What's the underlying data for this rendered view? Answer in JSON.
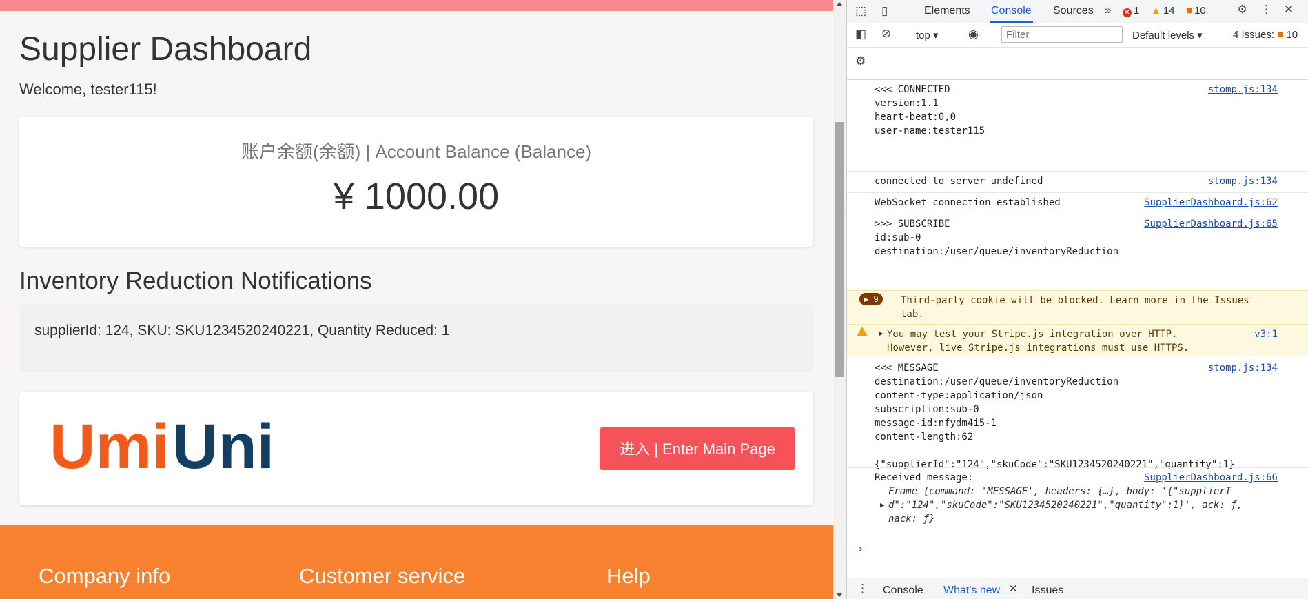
{
  "app": {
    "title": "Supplier Dashboard",
    "welcome": "Welcome, tester115!",
    "balance_label": "账户余额(余额) | Account Balance (Balance)",
    "balance_amount": "¥ 1000.00",
    "notifications_heading": "Inventory Reduction Notifications",
    "notification_text": "supplierId: 124, SKU: SKU1234520240221, Quantity Reduced: 1",
    "logo_text_1": "Umi",
    "logo_text_2": "Uni",
    "enter_button": "进入 | Enter Main Page",
    "footer": {
      "col1": "Company info",
      "col2": "Customer service",
      "col3": "Help"
    },
    "colors": {
      "top_bar": "#f8878e",
      "button": "#f5525a",
      "footer": "#f7812e",
      "logo_orange": "#f05a1a",
      "logo_navy": "#143f63"
    }
  },
  "devtools": {
    "tabs": [
      "Elements",
      "Console",
      "Sources"
    ],
    "active_tab": "Console",
    "more_tabs_icon": "chevron-double-right-icon",
    "errors_count": "1",
    "warnings_count": "14",
    "issues_count": "10",
    "toolbar": {
      "context": "top",
      "filter_placeholder": "Filter",
      "levels": "Default levels",
      "issues_label": "4 Issues:",
      "issues_badge": "10"
    },
    "messages": [
      {
        "text": "<<< CONNECTED\nversion:1.1\nheart-beat:0,0\nuser-name:tester115",
        "source": "stomp.js:134"
      },
      {
        "text": "connected to server undefined",
        "source": "stomp.js:134"
      },
      {
        "text": "WebSocket connection established",
        "source": "SupplierDashboard.js:62"
      },
      {
        "text": ">>> SUBSCRIBE\nid:sub-0\ndestination:/user/queue/inventoryReduction",
        "source": "SupplierDashboard.js:65"
      },
      {
        "count": "9",
        "text": "Third-party cookie will be blocked. Learn more in the Issues\ntab."
      },
      {
        "text": "You may test your Stripe.js integration over HTTP.\nHowever, live Stripe.js integrations must use HTTPS.",
        "source": "v3:1"
      },
      {
        "text": "<<< MESSAGE\ndestination:/user/queue/inventoryReduction\ncontent-type:application/json\nsubscription:sub-0\nmessage-id:nfydm4i5-1\ncontent-length:62\n\n{\"supplierId\":\"124\",\"skuCode\":\"SKU1234520240221\",\"quantity\":1}",
        "source": "stomp.js:134"
      },
      {
        "text": "Received message:",
        "source": "SupplierDashboard.js:66"
      },
      {
        "text": "Frame {command: 'MESSAGE', headers: {…}, body: '{\"supplierI\nd\":\"124\",\"skuCode\":\"SKU1234520240221\",\"quantity\":1}', ack: ƒ,\nnack: ƒ}"
      }
    ],
    "drawer_tabs": [
      "Console",
      "What's new",
      "Issues"
    ],
    "drawer_active": "What's new"
  }
}
